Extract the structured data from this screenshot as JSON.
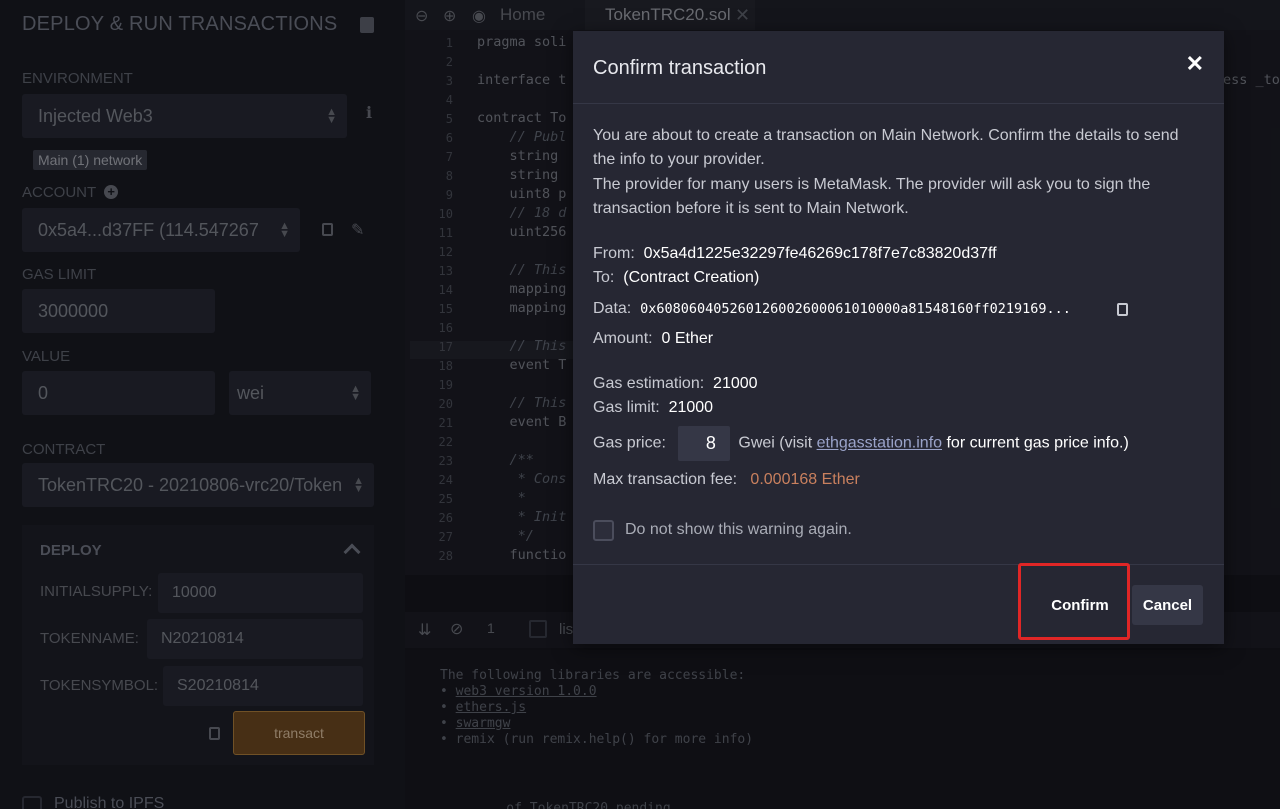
{
  "left_panel": {
    "title": "DEPLOY & RUN TRANSACTIONS",
    "environment_label": "ENVIRONMENT",
    "environment_value": "Injected Web3",
    "network_badge": "Main (1) network",
    "account_label": "ACCOUNT",
    "account_value": "0x5a4...d37FF (114.547267",
    "gas_limit_label": "GAS LIMIT",
    "gas_limit_value": "3000000",
    "value_label": "VALUE",
    "value_amount": "0",
    "value_unit": "wei",
    "contract_label": "CONTRACT",
    "contract_value": "TokenTRC20 - 20210806-vrc20/Token",
    "deploy": {
      "title": "DEPLOY",
      "params": [
        {
          "label": "INITIALSUPPLY:",
          "value": "10000"
        },
        {
          "label": "TOKENNAME:",
          "value": "N20210814"
        },
        {
          "label": "TOKENSYMBOL:",
          "value": "S20210814"
        }
      ],
      "transact_label": "transact"
    },
    "publish_label": "Publish to IPFS"
  },
  "editor": {
    "tab_home": "Home",
    "tab_file": "TokenTRC20.sol",
    "line_numbers": [
      "1",
      "2",
      "3",
      "4",
      "5",
      "6",
      "7",
      "8",
      "9",
      "10",
      "11",
      "12",
      "13",
      "14",
      "15",
      "16",
      "17",
      "18",
      "19",
      "20",
      "21",
      "22",
      "23",
      "24",
      "25",
      "26",
      "27",
      "28"
    ],
    "code_lines": [
      "pragma soli",
      "",
      "interface t",
      "",
      "contract To",
      "    // Publ",
      "    string",
      "    string",
      "    uint8 p",
      "    // 18 d",
      "    uint256",
      "",
      "    // This",
      "    mapping",
      "    mapping",
      "",
      "    // This",
      "    event T",
      "",
      "    // This",
      "    event B",
      "",
      "    /**",
      "     * Cons",
      "     *",
      "     * Init",
      "     */",
      "    functio"
    ],
    "right_edge_text": "ess _to"
  },
  "terminal": {
    "counter": "1",
    "listen_label": "lis",
    "lines": [
      {
        "text": "The following libraries are accessible:",
        "link": false
      },
      {
        "text": "web3 version 1.0.0",
        "link": true
      },
      {
        "text": "ethers.js",
        "link": true
      },
      {
        "text": "swarmgw",
        "link": true
      },
      {
        "text": "remix (run remix.help() for more info)",
        "link": false
      }
    ],
    "bottom_text": "... of TokenTRC20 pending..."
  },
  "modal": {
    "title": "Confirm transaction",
    "intro_line1": "You are about to create a transaction on Main Network. Confirm the details to send the info to your provider.",
    "intro_line2": "The provider for many users is MetaMask. The provider will ask you to sign the transaction before it is sent to Main Network.",
    "from_label": "From:",
    "from_value": "0x5a4d1225e32297fe46269c178f7e7c83820d37ff",
    "to_label": "To:",
    "to_value": "(Contract Creation)",
    "data_label": "Data:",
    "data_value": "0x608060405260126002600061010000a81548160ff0219169...",
    "amount_label": "Amount:",
    "amount_value": "0 Ether",
    "gas_estimation_label": "Gas estimation:",
    "gas_estimation_value": "21000",
    "gas_limit_label": "Gas limit:",
    "gas_limit_value": "21000",
    "gas_price_label": "Gas price:",
    "gas_price_value": "8",
    "gas_price_unit_pre": "Gwei (visit",
    "gas_price_link": "ethgasstation.info",
    "gas_price_unit_post": "for current gas price info.)",
    "max_fee_label": "Max transaction fee:",
    "max_fee_value": "0.000168 Ether",
    "checkbox_label": "Do not show this warning again.",
    "confirm_label": "Confirm",
    "cancel_label": "Cancel"
  },
  "colors": {
    "accent_fee": "#c9805e",
    "highlight_box": "#e02626",
    "transact_button": "#6b4620"
  }
}
